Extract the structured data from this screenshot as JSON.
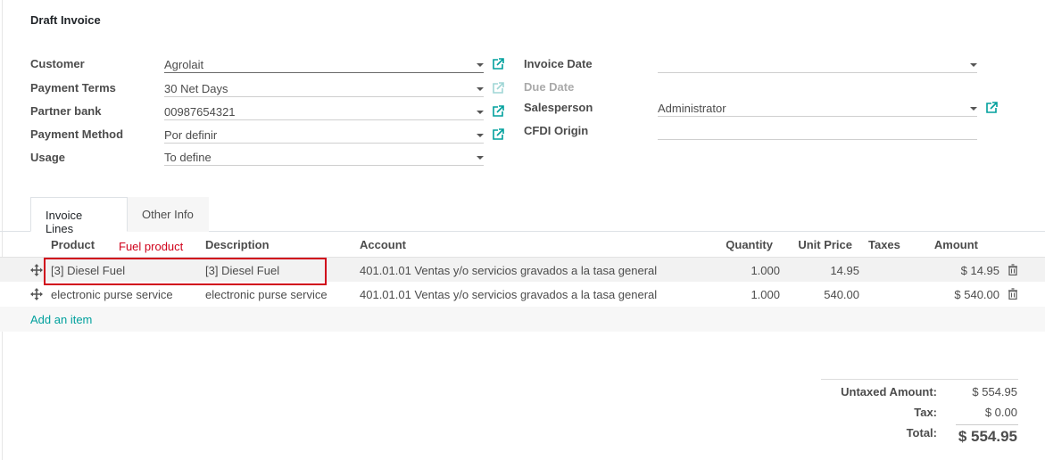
{
  "form": {
    "title": "Draft Invoice",
    "left_fields": [
      {
        "label": "Customer",
        "value": "Agrolait"
      },
      {
        "label": "Payment Terms",
        "value": "30 Net Days"
      },
      {
        "label": "Partner bank",
        "value": "00987654321"
      },
      {
        "label": "Payment Method",
        "value": "Por definir"
      },
      {
        "label": "Usage",
        "value": "To define"
      }
    ],
    "right_fields": [
      {
        "label": "Invoice Date",
        "value": ""
      },
      {
        "label": "Due Date",
        "value": ""
      },
      {
        "label": "Salesperson",
        "value": "Administrator"
      },
      {
        "label": "CFDI Origin",
        "value": ""
      }
    ]
  },
  "tabs": [
    {
      "label": "Invoice Lines",
      "active": true
    },
    {
      "label": "Other Info",
      "active": false
    }
  ],
  "lines": {
    "headers": {
      "product": "Product",
      "description": "Description",
      "account": "Account",
      "quantity": "Quantity",
      "unit_price": "Unit Price",
      "taxes": "Taxes",
      "amount": "Amount"
    },
    "rows": [
      {
        "product": "[3] Diesel Fuel",
        "description": "[3] Diesel Fuel",
        "account": "401.01.01 Ventas y/o servicios gravados a la tasa general",
        "quantity": "1.000",
        "unit_price": "14.95",
        "taxes": "",
        "amount": "$ 14.95"
      },
      {
        "product": "electronic purse service",
        "description": "electronic purse service",
        "account": "401.01.01 Ventas y/o servicios gravados a la tasa general",
        "quantity": "1.000",
        "unit_price": "540.00",
        "taxes": "",
        "amount": "$ 540.00"
      }
    ],
    "add_item_label": "Add an item"
  },
  "annotation": {
    "label": "Fuel product",
    "color": "#d0021b"
  },
  "totals": {
    "untaxed_label": "Untaxed Amount:",
    "untaxed_value": "$ 554.95",
    "tax_label": "Tax:",
    "tax_value": "$ 0.00",
    "total_label": "Total:",
    "total_value": "$ 554.95"
  },
  "colors": {
    "accent": "#00a09d",
    "annotation": "#d0021b"
  },
  "icons": {
    "external": "external-link-icon",
    "handle": "drag-handle-icon",
    "trash": "trash-icon"
  }
}
